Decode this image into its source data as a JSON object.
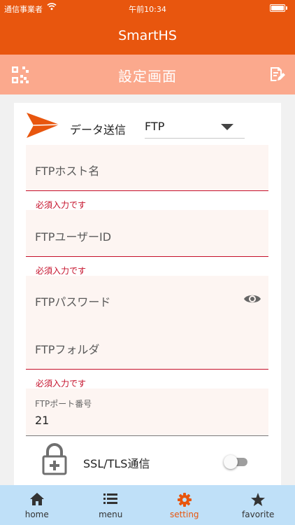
{
  "status_bar": {
    "carrier": "通信事業者",
    "time": "午前10:34"
  },
  "app": {
    "title": "SmartHS"
  },
  "header": {
    "title": "設定画面",
    "left_icon": "qr-code-icon",
    "right_icon": "edit-document-icon"
  },
  "send": {
    "label": "データ送信",
    "selected": "FTP"
  },
  "fields": {
    "host": {
      "placeholder": "FTPホスト名",
      "error": "必須入力です"
    },
    "user": {
      "placeholder": "FTPユーザーID",
      "error": "必須入力です"
    },
    "password": {
      "placeholder": "FTPパスワード",
      "icon": "eye-icon"
    },
    "folder": {
      "placeholder": "FTPフォルダ",
      "error": "必須入力です"
    },
    "port": {
      "label": "FTPポート番号",
      "value": "21"
    }
  },
  "ssl": {
    "label": "SSL/TLS通信",
    "enabled": false
  },
  "tabs": [
    {
      "label": "home",
      "icon": "home-icon"
    },
    {
      "label": "menu",
      "icon": "menu-list-icon"
    },
    {
      "label": "setting",
      "icon": "gear-icon",
      "active": true
    },
    {
      "label": "favorite",
      "icon": "star-icon"
    }
  ],
  "colors": {
    "primary": "#e8560e",
    "header": "#fba98d",
    "error": "#c5102a",
    "tabbar": "#bfe0f8"
  }
}
